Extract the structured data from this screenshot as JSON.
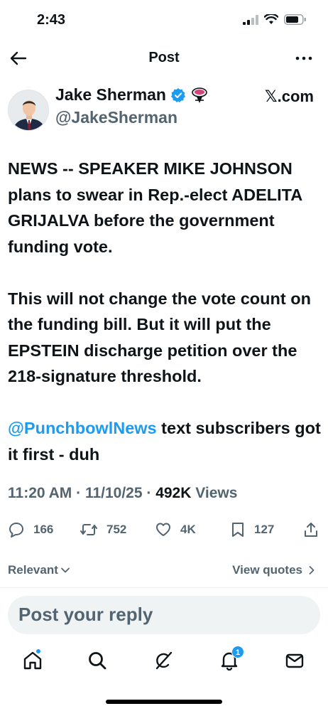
{
  "status_bar": {
    "time": "2:43"
  },
  "nav": {
    "title": "Post"
  },
  "author": {
    "name": "Jake Sherman",
    "handle": "@JakeSherman",
    "source": "𝕏.com"
  },
  "tweet": {
    "text": "NEWS -- SPEAKER MIKE JOHNSON plans to swear in Rep.-elect ADELITA GRIJALVA before the government funding vote.\n\nThis will not change the vote count on the funding bill. But it will put the EPSTEIN discharge petition over the 218-signature threshold.\n\n",
    "mention": "@PunchbowlNews",
    "text_after_mention": " text subscribers got it first - duh"
  },
  "meta": {
    "time": "11:20 AM",
    "separator": " · ",
    "date": "11/10/25",
    "views_count": "492K",
    "views_label": " Views"
  },
  "actions": {
    "replies": "166",
    "reposts": "752",
    "likes": "4K",
    "bookmarks": "127"
  },
  "sort": {
    "label": "Relevant",
    "view_quotes": "View quotes"
  },
  "reply": {
    "placeholder": "Post your reply"
  },
  "tabs": {
    "notifications_badge": "1"
  },
  "colors": {
    "accent": "#1d9bf0",
    "text_primary": "#0f1419",
    "text_secondary": "#536471"
  },
  "icons": [
    "back-arrow-icon",
    "more-icon",
    "verified-icon",
    "affiliate-badge-icon",
    "reply-icon",
    "repost-icon",
    "like-icon",
    "bookmark-icon",
    "share-icon",
    "home-icon",
    "search-icon",
    "grok-icon",
    "notifications-icon",
    "messages-icon"
  ]
}
